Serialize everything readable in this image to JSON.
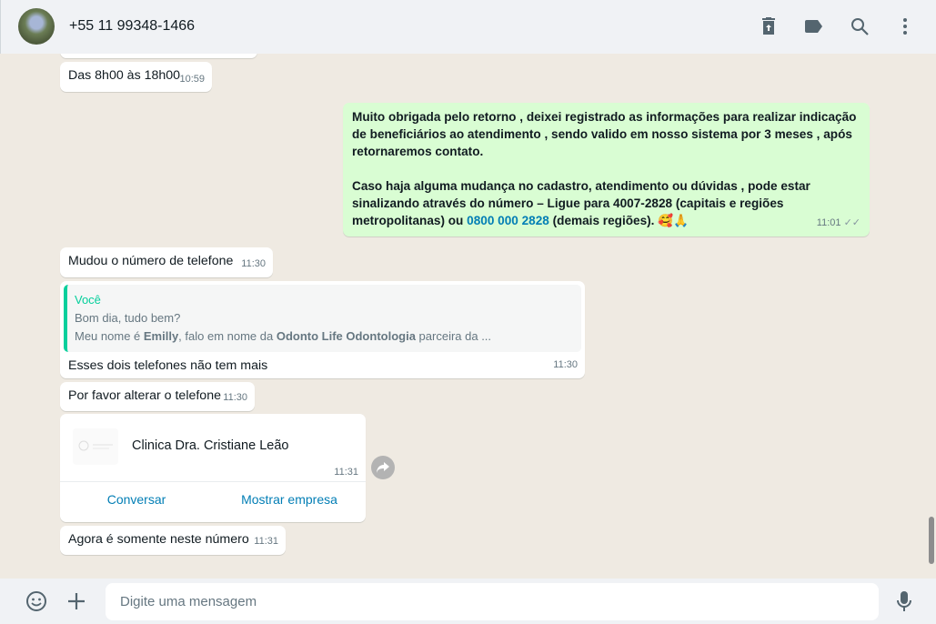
{
  "header": {
    "contact": "+55 11 99348-1466",
    "icons": [
      "delete-upload-icon",
      "label-icon",
      "search-icon",
      "menu-icon"
    ]
  },
  "messages": [
    {
      "text": "Das 8h00 às 18h00",
      "time": "10:59"
    },
    {
      "outgoing": true,
      "para1": "Muito obrigada pelo retorno , deixei registrado as informações para realizar indicação de beneficiários ao atendimento , sendo valido em nosso sistema por 3 meses , após retornaremos contato.",
      "para2a": "Caso haja alguma mudança no cadastro, atendimento ou dúvidas  , pode estar sinalizando através do número – Ligue para 4007-2828 (capitais e regiões metropolitanas) ou ",
      "link": "0800 000 2828",
      "para2b": " (demais regiões). ",
      "emoji": "🥰🙏",
      "time": "11:01"
    },
    {
      "text": "Mudou o número de telefone",
      "time": "11:30"
    },
    {
      "quote": {
        "author": "Você",
        "line1": "Bom dia, tudo bem?",
        "line2a": "Meu nome é ",
        "b1": "Emilly",
        "line2b": ", falo em nome da ",
        "b2": "Odonto Life Odontologia",
        "line2c": " parceira da ..."
      },
      "text": "Esses dois telefones não tem mais",
      "time": "11:30"
    },
    {
      "text": "Por favor alterar o telefone",
      "time": "11:30"
    },
    {
      "contact_card": {
        "name": "Clinica Dra. Cristiane Leão",
        "time": "11:31",
        "action1": "Conversar",
        "action2": "Mostrar empresa"
      }
    },
    {
      "text": "Agora é somente neste número",
      "time": "11:31"
    }
  ],
  "footer": {
    "placeholder": "Digite uma mensagem"
  }
}
